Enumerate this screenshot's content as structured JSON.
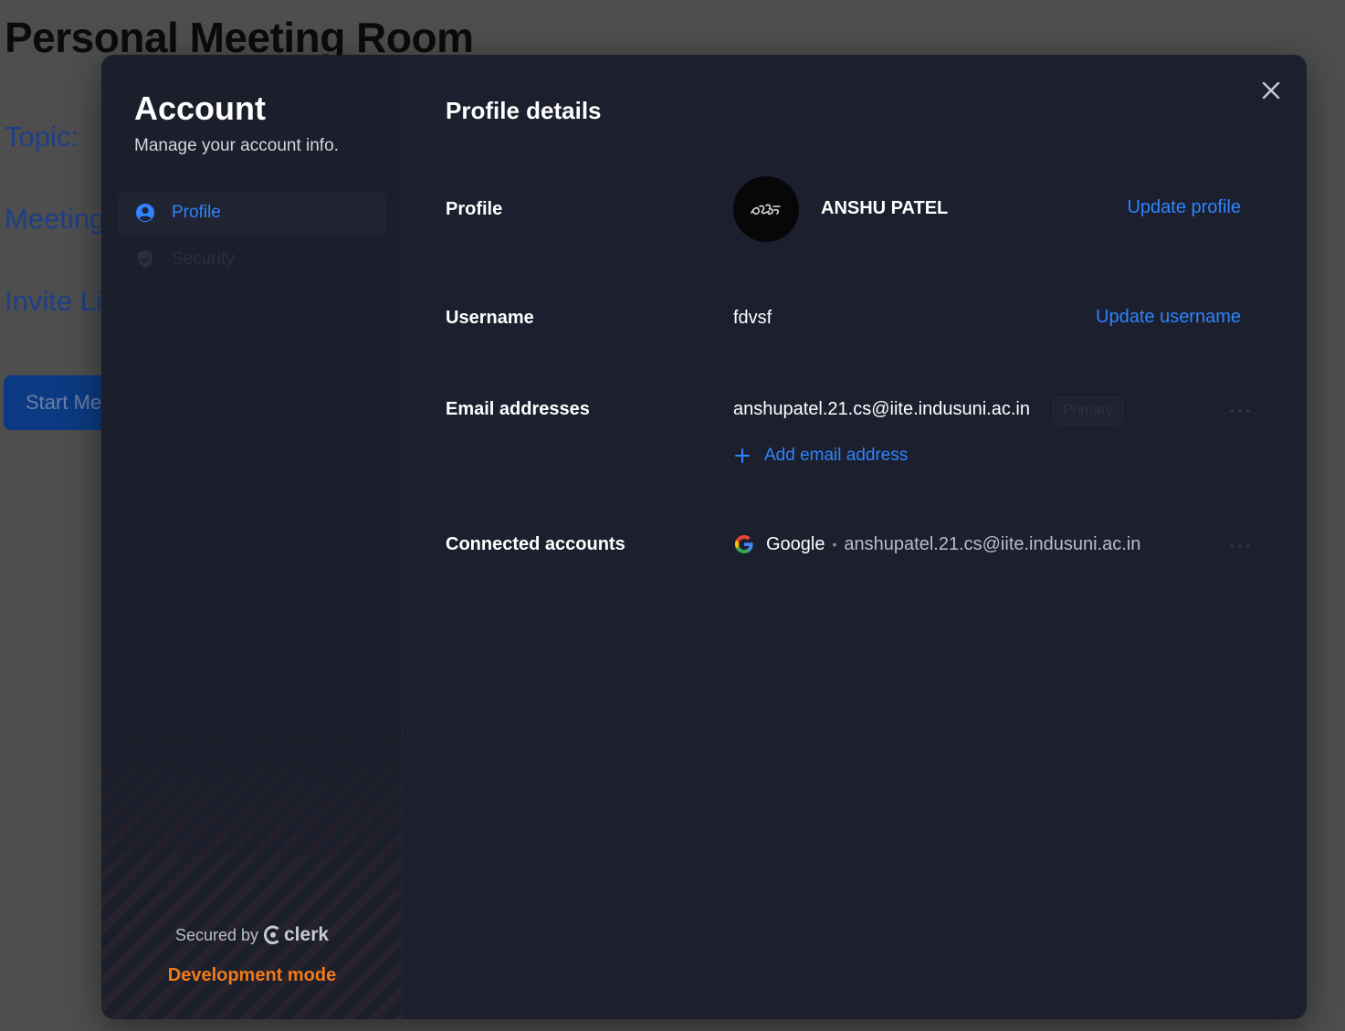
{
  "background": {
    "title": "Personal Meeting Room",
    "topic_label": "Topic:",
    "meeting_label": "Meeting",
    "invite_label": "Invite Li",
    "start_button": "Start Me"
  },
  "sidebar": {
    "title": "Account",
    "subtitle": "Manage your account info.",
    "items": [
      {
        "label": "Profile",
        "icon": "user-circle-icon",
        "active": true
      },
      {
        "label": "Security",
        "icon": "shield-check-icon",
        "active": false
      }
    ],
    "secured_by": "Secured by",
    "brand": "clerk",
    "dev_mode": "Development mode"
  },
  "content": {
    "title": "Profile details",
    "profile": {
      "label": "Profile",
      "name": "ANSHU PATEL",
      "action": "Update profile"
    },
    "username": {
      "label": "Username",
      "value": "fdvsf",
      "action": "Update username"
    },
    "emails": {
      "label": "Email addresses",
      "primary_email": "anshupatel.21.cs@iite.indusuni.ac.in",
      "badge": "Primary",
      "add_action": "Add email address"
    },
    "connected": {
      "label": "Connected accounts",
      "provider": "Google",
      "email": "anshupatel.21.cs@iite.indusuni.ac.in"
    }
  },
  "colors": {
    "accent": "#2f84ff",
    "dev_mode": "#f07a1a",
    "modal_bg": "#1c1f2e"
  }
}
